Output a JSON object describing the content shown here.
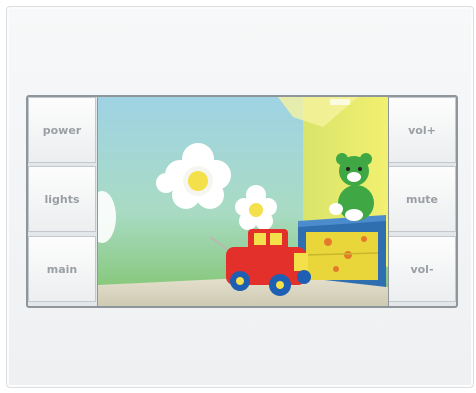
{
  "left_buttons": [
    {
      "label": "power"
    },
    {
      "label": "lights"
    },
    {
      "label": "main"
    }
  ],
  "right_buttons": [
    {
      "label": "vol+"
    },
    {
      "label": "mute"
    },
    {
      "label": "vol-"
    }
  ],
  "colors": {
    "panel": "#f2f4f6",
    "button_text": "#9a9fa4",
    "bezel_border": "#8e959b"
  },
  "screen": {
    "image": "childrens-room-photo"
  }
}
